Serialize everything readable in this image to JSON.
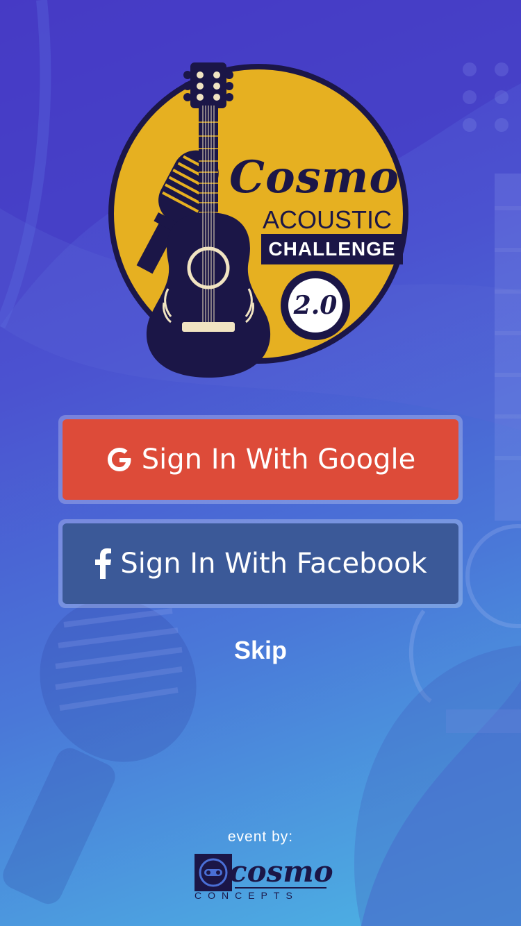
{
  "logo": {
    "brand": "Cosmo",
    "line1": "ACOUSTIC",
    "line2": "CHALLENGE",
    "version": "2.0"
  },
  "buttons": {
    "google_label": "Sign In With Google",
    "google_icon": "google-g-icon",
    "facebook_label": "Sign In With Facebook",
    "facebook_icon": "facebook-f-icon"
  },
  "skip_label": "Skip",
  "footer": {
    "event_by": "event by:",
    "sponsor_name": "cosmo",
    "sponsor_sub": "CONCEPTS"
  },
  "colors": {
    "google": "#dd4b39",
    "facebook": "#3b5998",
    "logo_yellow": "#e6b021",
    "logo_navy": "#1b1647"
  }
}
